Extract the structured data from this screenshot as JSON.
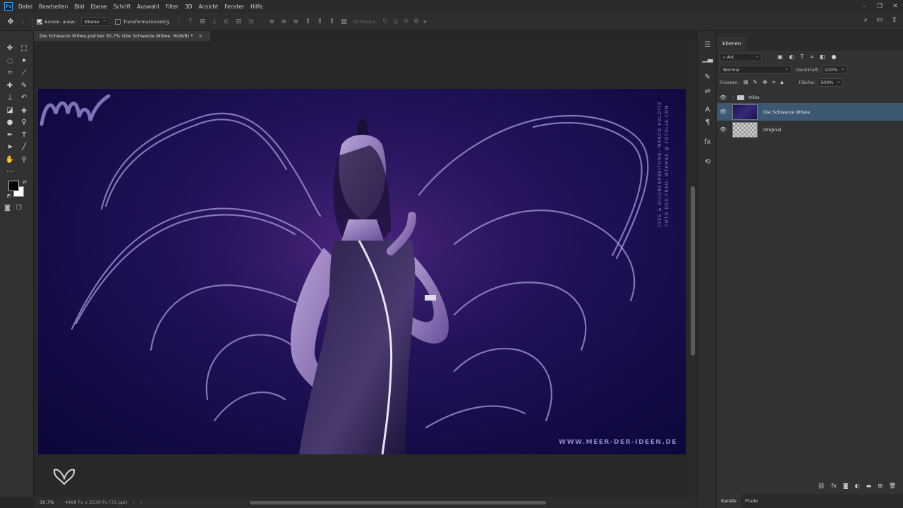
{
  "menubar": {
    "logo": "Ps",
    "items": [
      "Datei",
      "Bearbeiten",
      "Bild",
      "Ebene",
      "Schrift",
      "Auswahl",
      "Filter",
      "3D",
      "Ansicht",
      "Fenster",
      "Hilfe"
    ]
  },
  "options": {
    "auto_select_label": "Autom. ausw.:",
    "auto_select_value": "Ebene",
    "transform_label": "Transformationsstrg.",
    "mode3d_label": "3D-Modus:"
  },
  "document": {
    "tab_title": "Die Schwarze Witwe.psd bei 30,7% (Die Schwarze Witwe, RGB/8) *",
    "credit_line1": "IDEE & BILDBEARBEITUNG: MARCO KOLDITZ",
    "credit_line2": "FOTO DER FRAU: WTAMAS @ FOTOLIA.COM",
    "site": "WWW.MEER-DER-IDEEN.DE"
  },
  "status": {
    "zoom": "30,7%",
    "size_info": "4498 Px x 2530 Px (72 ppi)"
  },
  "layers_panel": {
    "tab": "Ebenen",
    "filter_kind": "Art",
    "blend_mode": "Normal",
    "opacity_label": "Deckkraft:",
    "opacity_value": "100%",
    "lock_label": "Fixieren:",
    "fill_label": "Fläche:",
    "fill_value": "100%",
    "layers": [
      {
        "name": "Infos",
        "type": "group"
      },
      {
        "name": "Die Schwarze Witwe",
        "type": "layer",
        "active": true
      },
      {
        "name": "Original",
        "type": "layer"
      }
    ],
    "bottom_tabs": [
      "Kanäle",
      "Pfade"
    ]
  },
  "colors": {
    "foreground": "#000000",
    "background": "#ffffff",
    "active_layer": "#3d5873",
    "artwork_bg": "#120b44"
  }
}
